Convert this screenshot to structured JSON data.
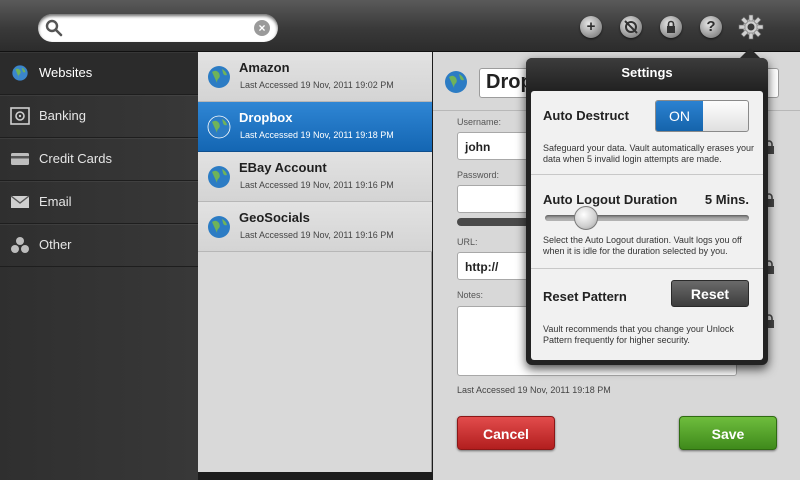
{
  "search": {
    "placeholder": "",
    "value": ""
  },
  "toolbar": {
    "icons": [
      "add-icon",
      "no-sync-icon",
      "lock-icon",
      "help-icon",
      "gear-icon"
    ]
  },
  "sidebar": {
    "items": [
      {
        "label": "Websites",
        "icon": "globe-icon"
      },
      {
        "label": "Banking",
        "icon": "safe-icon"
      },
      {
        "label": "Credit Cards",
        "icon": "credit-card-icon"
      },
      {
        "label": "Email",
        "icon": "envelope-icon"
      },
      {
        "label": "Other",
        "icon": "other-icon"
      }
    ]
  },
  "list": {
    "items": [
      {
        "name": "Amazon",
        "sub": "Last Accessed 19 Nov, 2011 19:02 PM"
      },
      {
        "name": "Dropbox",
        "sub": "Last Accessed 19 Nov, 2011 19:18 PM"
      },
      {
        "name": "EBay Account",
        "sub": "Last Accessed 19 Nov, 2011 19:16 PM"
      },
      {
        "name": "GeoSocials",
        "sub": "Last Accessed 19 Nov, 2011 19:16 PM"
      }
    ]
  },
  "detail": {
    "title": "Dropbox",
    "username_label": "Username:",
    "username": "john",
    "password_label": "Password:",
    "url_label": "URL:",
    "url": "http://",
    "notes_label": "Notes:",
    "last_accessed": "Last Accessed 19 Nov, 2011 19:18 PM",
    "cancel": "Cancel",
    "save": "Save"
  },
  "settings": {
    "title": "Settings",
    "auto_destruct": {
      "title": "Auto Destruct",
      "toggle": "ON",
      "desc": "Safeguard your data. Vault automatically erases your data when 5 invalid login attempts are made."
    },
    "auto_logout": {
      "title": "Auto Logout Duration",
      "value": "5 Mins.",
      "slider_fraction": 0.2,
      "desc": "Select the Auto Logout duration. Vault logs you off when it is idle for the duration selected by you."
    },
    "reset_pattern": {
      "title": "Reset Pattern",
      "button": "Reset",
      "desc": "Vault recommends that you change your Unlock Pattern frequently for higher security."
    }
  },
  "colors": {
    "selected_blue": "#1f77c6",
    "cancel_red": "#c92f2f",
    "save_green": "#56a72c"
  }
}
